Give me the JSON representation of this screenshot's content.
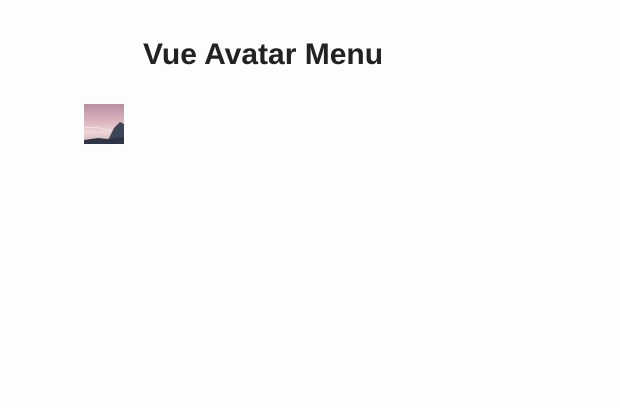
{
  "page": {
    "title": "Vue Avatar Menu"
  },
  "avatar": {
    "icon": "avatar-image-icon",
    "colors": {
      "sky_top": "#c9a3b3",
      "sky_mid": "#e7c6cc",
      "mountain": "#3d4656",
      "ground": "#2d3446"
    }
  }
}
